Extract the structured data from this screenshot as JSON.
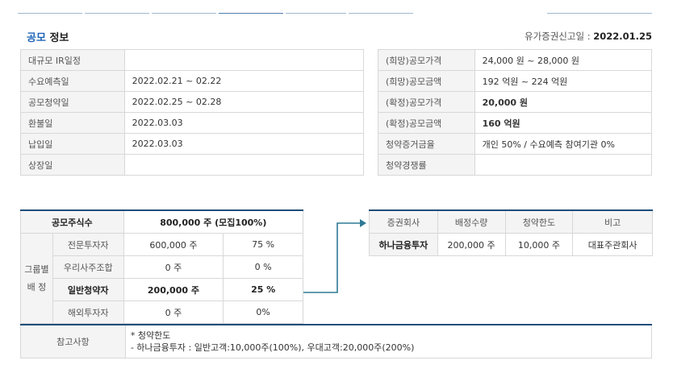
{
  "header": {
    "title_accent": "공모",
    "title_rest": " 정보",
    "filing_label": "유가증권신고일 : ",
    "filing_date": "2022.01.25"
  },
  "schedule": [
    {
      "label": "대규모 IR일정",
      "value": ""
    },
    {
      "label": "수요예측일",
      "value": "2022.02.21 ~ 02.22"
    },
    {
      "label": "공모청약일",
      "value": "2022.02.25 ~ 02.28"
    },
    {
      "label": "환불일",
      "value": "2022.03.03"
    },
    {
      "label": "납입일",
      "value": "2022.03.03"
    },
    {
      "label": "상장일",
      "value": ""
    }
  ],
  "pricing": [
    {
      "label": "(희망)공모가격",
      "value": "24,000 원 ~ 28,000 원"
    },
    {
      "label": "(희망)공모금액",
      "value": "192 억원  ~ 224 억원"
    },
    {
      "label": "(확정)공모가격",
      "value": "20,000 원"
    },
    {
      "label": "(확정)공모금액",
      "value": "160 억원"
    },
    {
      "label": "청약증거금율",
      "value": "개인 50% / 수요예측 참여기관 0%"
    },
    {
      "label": "청약경쟁률",
      "value": ""
    }
  ],
  "shares": {
    "header_label": "공모주식수",
    "header_value": "800,000 주 (모집100%)",
    "group_label_1": "그룹별",
    "group_label_2": "배 정",
    "rows": [
      {
        "label": "전문투자자",
        "shares": "600,000 주",
        "pct": "75 %"
      },
      {
        "label": "우리사주조합",
        "shares": "0 주",
        "pct": "0 %"
      },
      {
        "label": "일반청약자",
        "shares": "200,000 주",
        "pct": "25 %"
      },
      {
        "label": "해외투자자",
        "shares": "0 주",
        "pct": "0%"
      }
    ]
  },
  "brokers": {
    "headers": [
      "증권회사",
      "배정수량",
      "청약한도",
      "비고"
    ],
    "rows": [
      {
        "name": "하나금융투자",
        "qty": "200,000 주",
        "limit": "10,000 주",
        "note": "대표주관회사"
      }
    ]
  },
  "notes": {
    "label": "참고사항",
    "line1": "* 청약한도",
    "line2": "- 하나금융투자 : 일반고객:10,000주(100%), 우대고객:20,000주(200%)"
  },
  "colors": {
    "accent": "#1f64b8",
    "highlight": "#c8361d",
    "table_border": "#1f4e79"
  }
}
